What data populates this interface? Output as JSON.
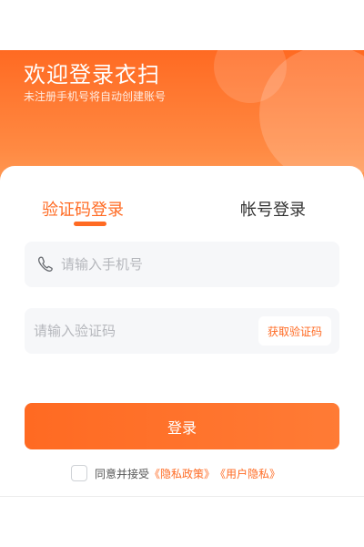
{
  "header": {
    "title": "欢迎登录衣扫",
    "subtitle": "未注册手机号将自动创建账号"
  },
  "tabs": {
    "sms_login": "验证码登录",
    "account_login": "帐号登录",
    "active": "sms_login"
  },
  "phone_field": {
    "icon": "phone-icon",
    "placeholder": "请输入手机号",
    "value": ""
  },
  "code_field": {
    "placeholder": "请输入验证码",
    "value": "",
    "get_code_label": "获取验证码"
  },
  "login_button": {
    "label": "登录"
  },
  "agreement": {
    "checked": false,
    "prefix": "同意并接受",
    "privacy": "《隐私政策》",
    "user": "《用户隐私》"
  },
  "colors": {
    "accent": "#ff6a22",
    "field_bg": "#f6f7f9",
    "text_dark": "#333333",
    "placeholder": "#b5b7bc"
  }
}
